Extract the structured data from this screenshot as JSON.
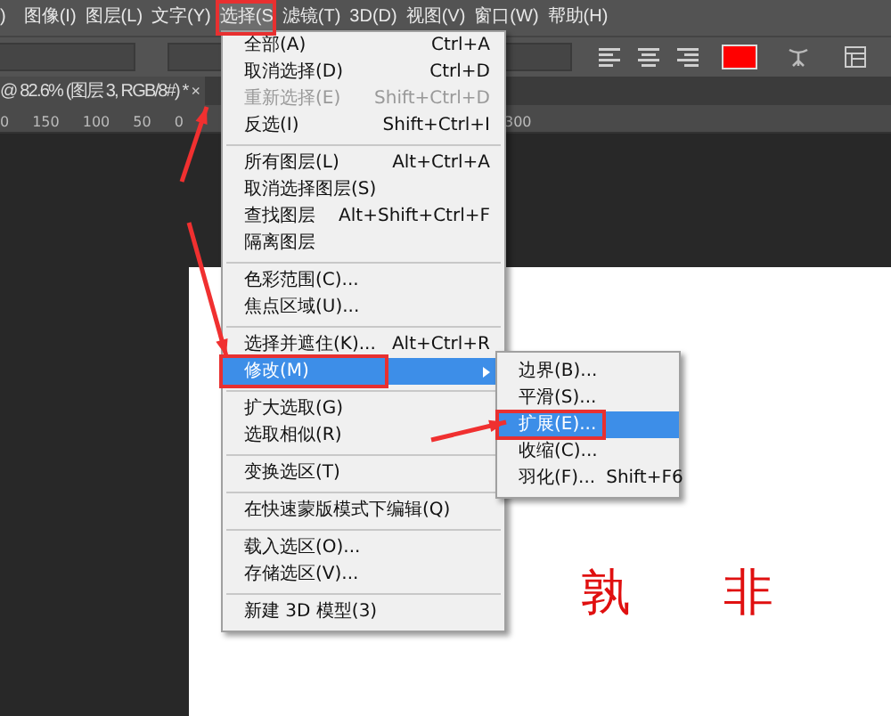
{
  "menubar": [
    {
      "label": ")",
      "selected": false
    },
    {
      "label": "图像(I)",
      "selected": false
    },
    {
      "label": "图层(L)",
      "selected": false
    },
    {
      "label": "文字(Y)",
      "selected": false
    },
    {
      "label": "选择(S",
      "selected": true
    },
    {
      "label": "滤镜(T)",
      "selected": false
    },
    {
      "label": "3D(D)",
      "selected": false
    },
    {
      "label": "视图(V)",
      "selected": false
    },
    {
      "label": "窗口(W)",
      "selected": false
    },
    {
      "label": "帮助(H)",
      "selected": false
    }
  ],
  "document_tab": {
    "title": "@ 82.6% (图层 3, RGB/8#) *",
    "close": "×"
  },
  "ruler": {
    "labels": [
      "0",
      "150",
      "100",
      "50",
      "0"
    ],
    "far_label": "300"
  },
  "canvas_text": [
    "孰",
    "非"
  ],
  "select_menu": {
    "items": [
      {
        "kind": "item",
        "label": "全部(A)",
        "shortcut": "Ctrl+A",
        "disabled": false,
        "selected": false
      },
      {
        "kind": "item",
        "label": "取消选择(D)",
        "shortcut": "Ctrl+D",
        "disabled": false,
        "selected": false
      },
      {
        "kind": "item",
        "label": "重新选择(E)",
        "shortcut": "Shift+Ctrl+D",
        "disabled": true,
        "selected": false
      },
      {
        "kind": "item",
        "label": "反选(I)",
        "shortcut": "Shift+Ctrl+I",
        "disabled": false,
        "selected": false
      },
      {
        "kind": "separator"
      },
      {
        "kind": "item",
        "label": "所有图层(L)",
        "shortcut": "Alt+Ctrl+A",
        "disabled": false,
        "selected": false
      },
      {
        "kind": "item",
        "label": "取消选择图层(S)",
        "disabled": false,
        "selected": false
      },
      {
        "kind": "item",
        "label": "查找图层",
        "shortcut": "Alt+Shift+Ctrl+F",
        "disabled": false,
        "selected": false
      },
      {
        "kind": "item",
        "label": "隔离图层",
        "disabled": false,
        "selected": false
      },
      {
        "kind": "separator"
      },
      {
        "kind": "item",
        "label": "色彩范围(C)...",
        "disabled": false,
        "selected": false
      },
      {
        "kind": "item",
        "label": "焦点区域(U)...",
        "disabled": false,
        "selected": false
      },
      {
        "kind": "separator"
      },
      {
        "kind": "item",
        "label": "选择并遮住(K)...",
        "shortcut": "Alt+Ctrl+R",
        "disabled": false,
        "selected": false
      },
      {
        "kind": "submenu",
        "label": "修改(M)",
        "disabled": false,
        "selected": true
      },
      {
        "kind": "separator"
      },
      {
        "kind": "item",
        "label": "扩大选取(G)",
        "disabled": false,
        "selected": false
      },
      {
        "kind": "item",
        "label": "选取相似(R)",
        "disabled": false,
        "selected": false
      },
      {
        "kind": "separator"
      },
      {
        "kind": "item",
        "label": "变换选区(T)",
        "disabled": false,
        "selected": false
      },
      {
        "kind": "separator"
      },
      {
        "kind": "item",
        "label": "在快速蒙版模式下编辑(Q)",
        "disabled": false,
        "selected": false
      },
      {
        "kind": "separator"
      },
      {
        "kind": "item",
        "label": "载入选区(O)...",
        "disabled": false,
        "selected": false
      },
      {
        "kind": "item",
        "label": "存储选区(V)...",
        "disabled": false,
        "selected": false
      },
      {
        "kind": "separator"
      },
      {
        "kind": "item",
        "label": "新建 3D 模型(3)",
        "disabled": false,
        "selected": false
      }
    ]
  },
  "modify_submenu": {
    "items": [
      {
        "kind": "item",
        "label": "边界(B)...",
        "disabled": false,
        "selected": false
      },
      {
        "kind": "item",
        "label": "平滑(S)...",
        "disabled": false,
        "selected": false
      },
      {
        "kind": "item",
        "label": "扩展(E)...",
        "disabled": false,
        "selected": true
      },
      {
        "kind": "item",
        "label": "收缩(C)...",
        "disabled": false,
        "selected": false
      },
      {
        "kind": "item",
        "label": "羽化(F)...",
        "shortcut": "Shift+F6",
        "disabled": false,
        "selected": false
      }
    ]
  }
}
